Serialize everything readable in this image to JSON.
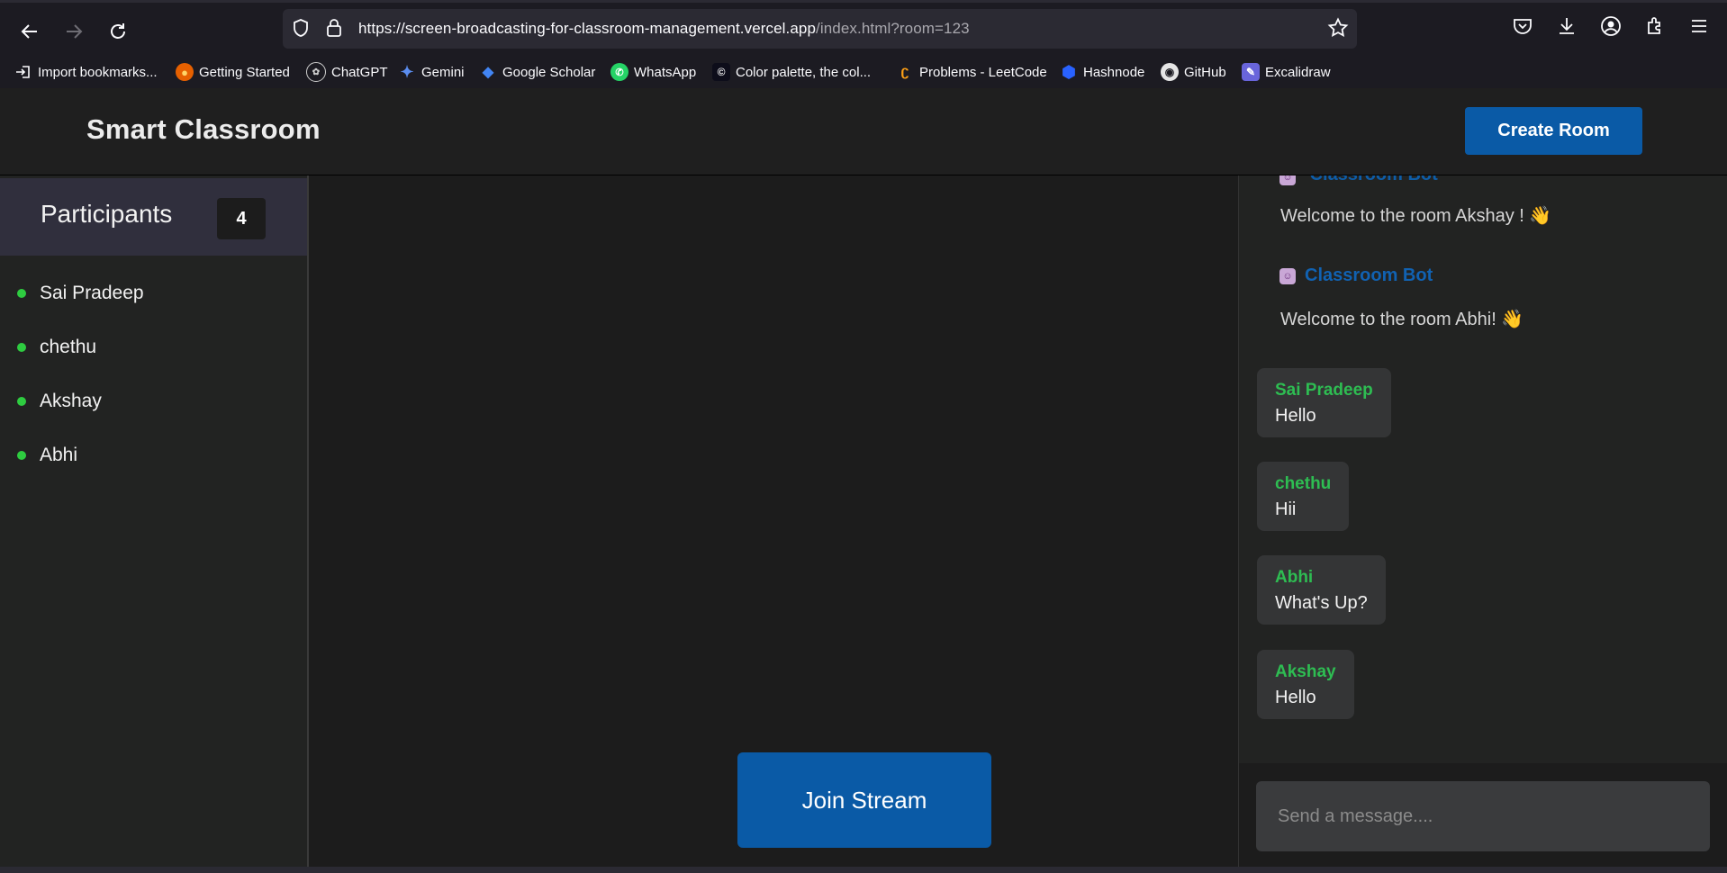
{
  "browser": {
    "url_host": "https://screen-broadcasting-for-classroom-management.vercel.app",
    "url_path": "/index.html?room=123",
    "bookmarks": [
      {
        "label": "Import bookmarks...",
        "icon": "import-icon"
      },
      {
        "label": "Getting Started",
        "icon": "firefox-icon"
      },
      {
        "label": "ChatGPT",
        "icon": "chatgpt-icon"
      },
      {
        "label": "Gemini",
        "icon": "gemini-icon"
      },
      {
        "label": "Google Scholar",
        "icon": "scholar-icon"
      },
      {
        "label": "WhatsApp",
        "icon": "whatsapp-icon"
      },
      {
        "label": "Color palette, the col...",
        "icon": "coolors-icon"
      },
      {
        "label": "Problems - LeetCode",
        "icon": "leetcode-icon"
      },
      {
        "label": "Hashnode",
        "icon": "hashnode-icon"
      },
      {
        "label": "GitHub",
        "icon": "github-icon"
      },
      {
        "label": "Excalidraw",
        "icon": "excalidraw-icon"
      }
    ]
  },
  "header": {
    "brand": "Smart Classroom",
    "create_room_label": "Create Room"
  },
  "participants": {
    "title": "Participants",
    "count": "4",
    "list": [
      "Sai Pradeep",
      "chethu",
      "Akshay",
      "Abhi"
    ]
  },
  "stream": {
    "join_label": "Join Stream"
  },
  "chat": {
    "bot_name": "Classroom Bot",
    "bot_messages": [
      "Welcome to the room Akshay ! 👋",
      "Welcome to the room Abhi! 👋"
    ],
    "messages": [
      {
        "sender": "Sai Pradeep",
        "text": "Hello"
      },
      {
        "sender": "chethu",
        "text": "Hii"
      },
      {
        "sender": "Abhi",
        "text": "What's Up?"
      },
      {
        "sender": "Akshay",
        "text": "Hello"
      }
    ],
    "input_placeholder": "Send a message...."
  },
  "colors": {
    "accent": "#0a5aa6",
    "online": "#2ecc40",
    "sender": "#2ebd52",
    "bot": "#1162b2"
  }
}
